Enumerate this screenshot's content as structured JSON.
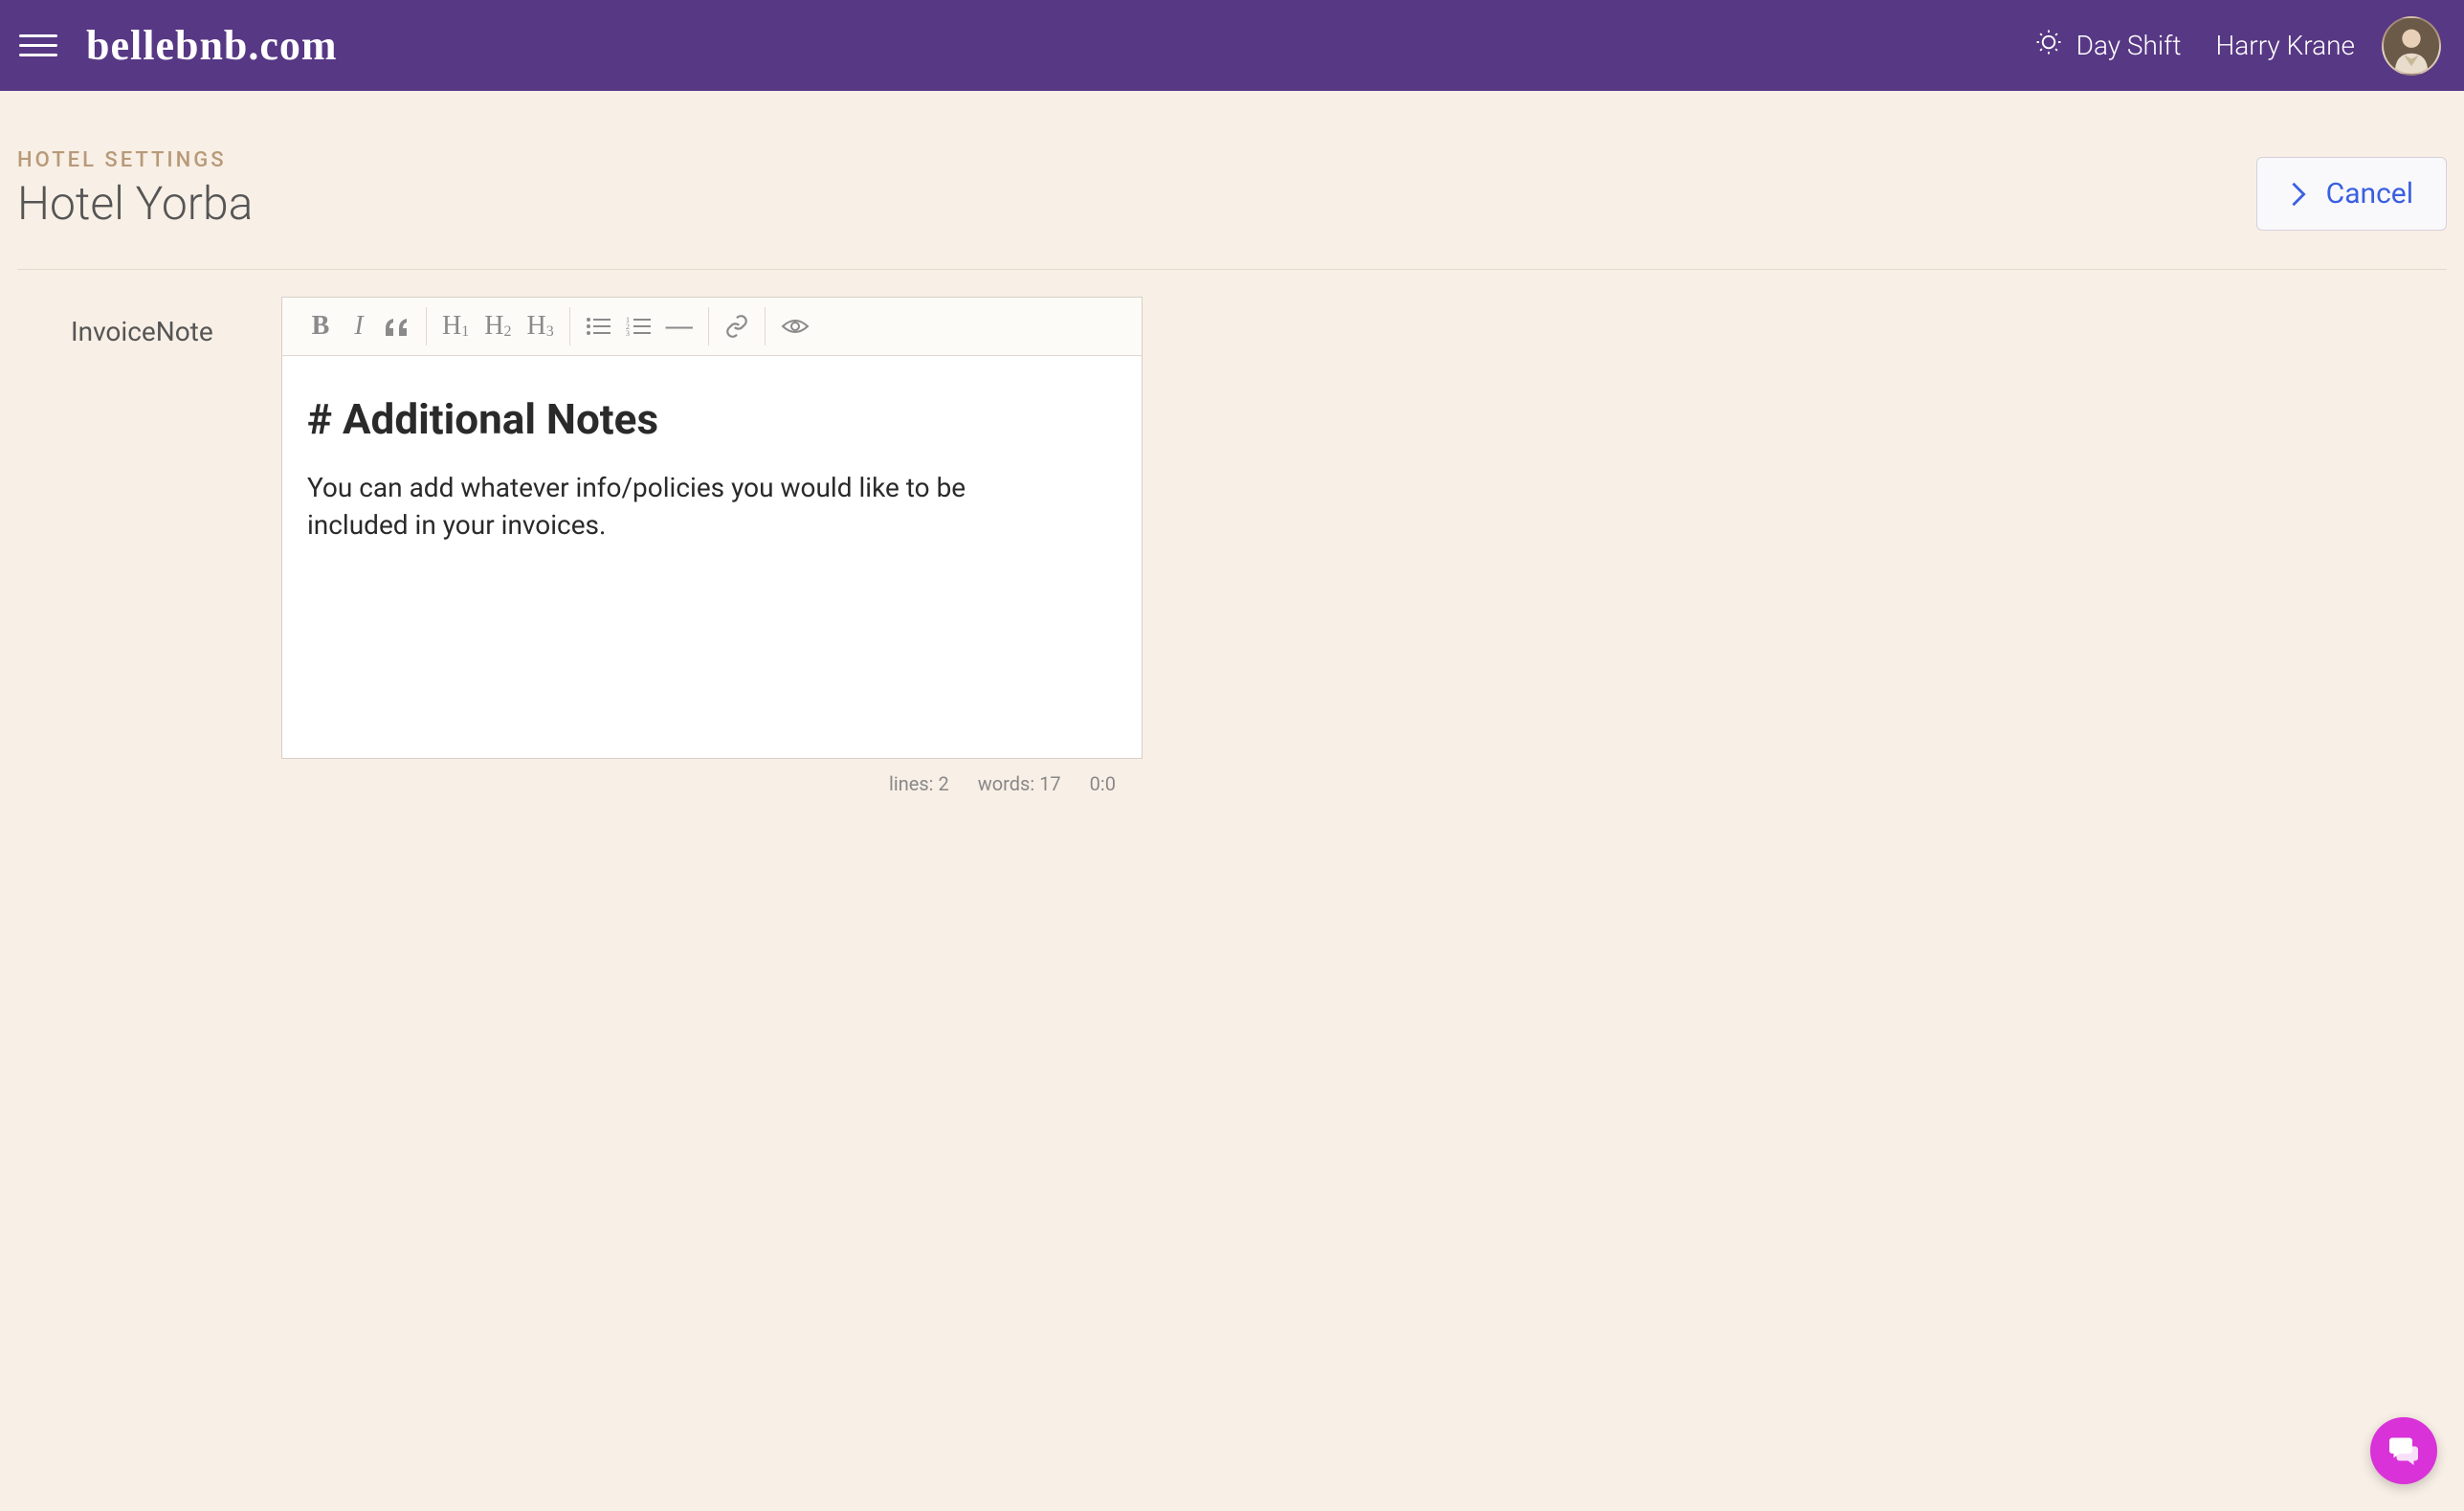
{
  "header": {
    "logo": "bellebnb.com",
    "shift_label": "Day Shift",
    "user_name": "Harry Krane"
  },
  "page": {
    "breadcrumb": "HOTEL SETTINGS",
    "title": "Hotel Yorba",
    "cancel_label": "Cancel"
  },
  "field": {
    "label": "InvoiceNote"
  },
  "editor": {
    "heading": "# Additional Notes",
    "paragraph": "You can add whatever info/policies you would like to be included in your invoices."
  },
  "status": {
    "lines_label": "lines:",
    "lines_value": "2",
    "words_label": "words:",
    "words_value": "17",
    "cursor": "0:0"
  },
  "toolbar": {
    "bold": "B",
    "italic": "I",
    "quote": "❝❝",
    "h_letter": "H",
    "rule": "—"
  }
}
